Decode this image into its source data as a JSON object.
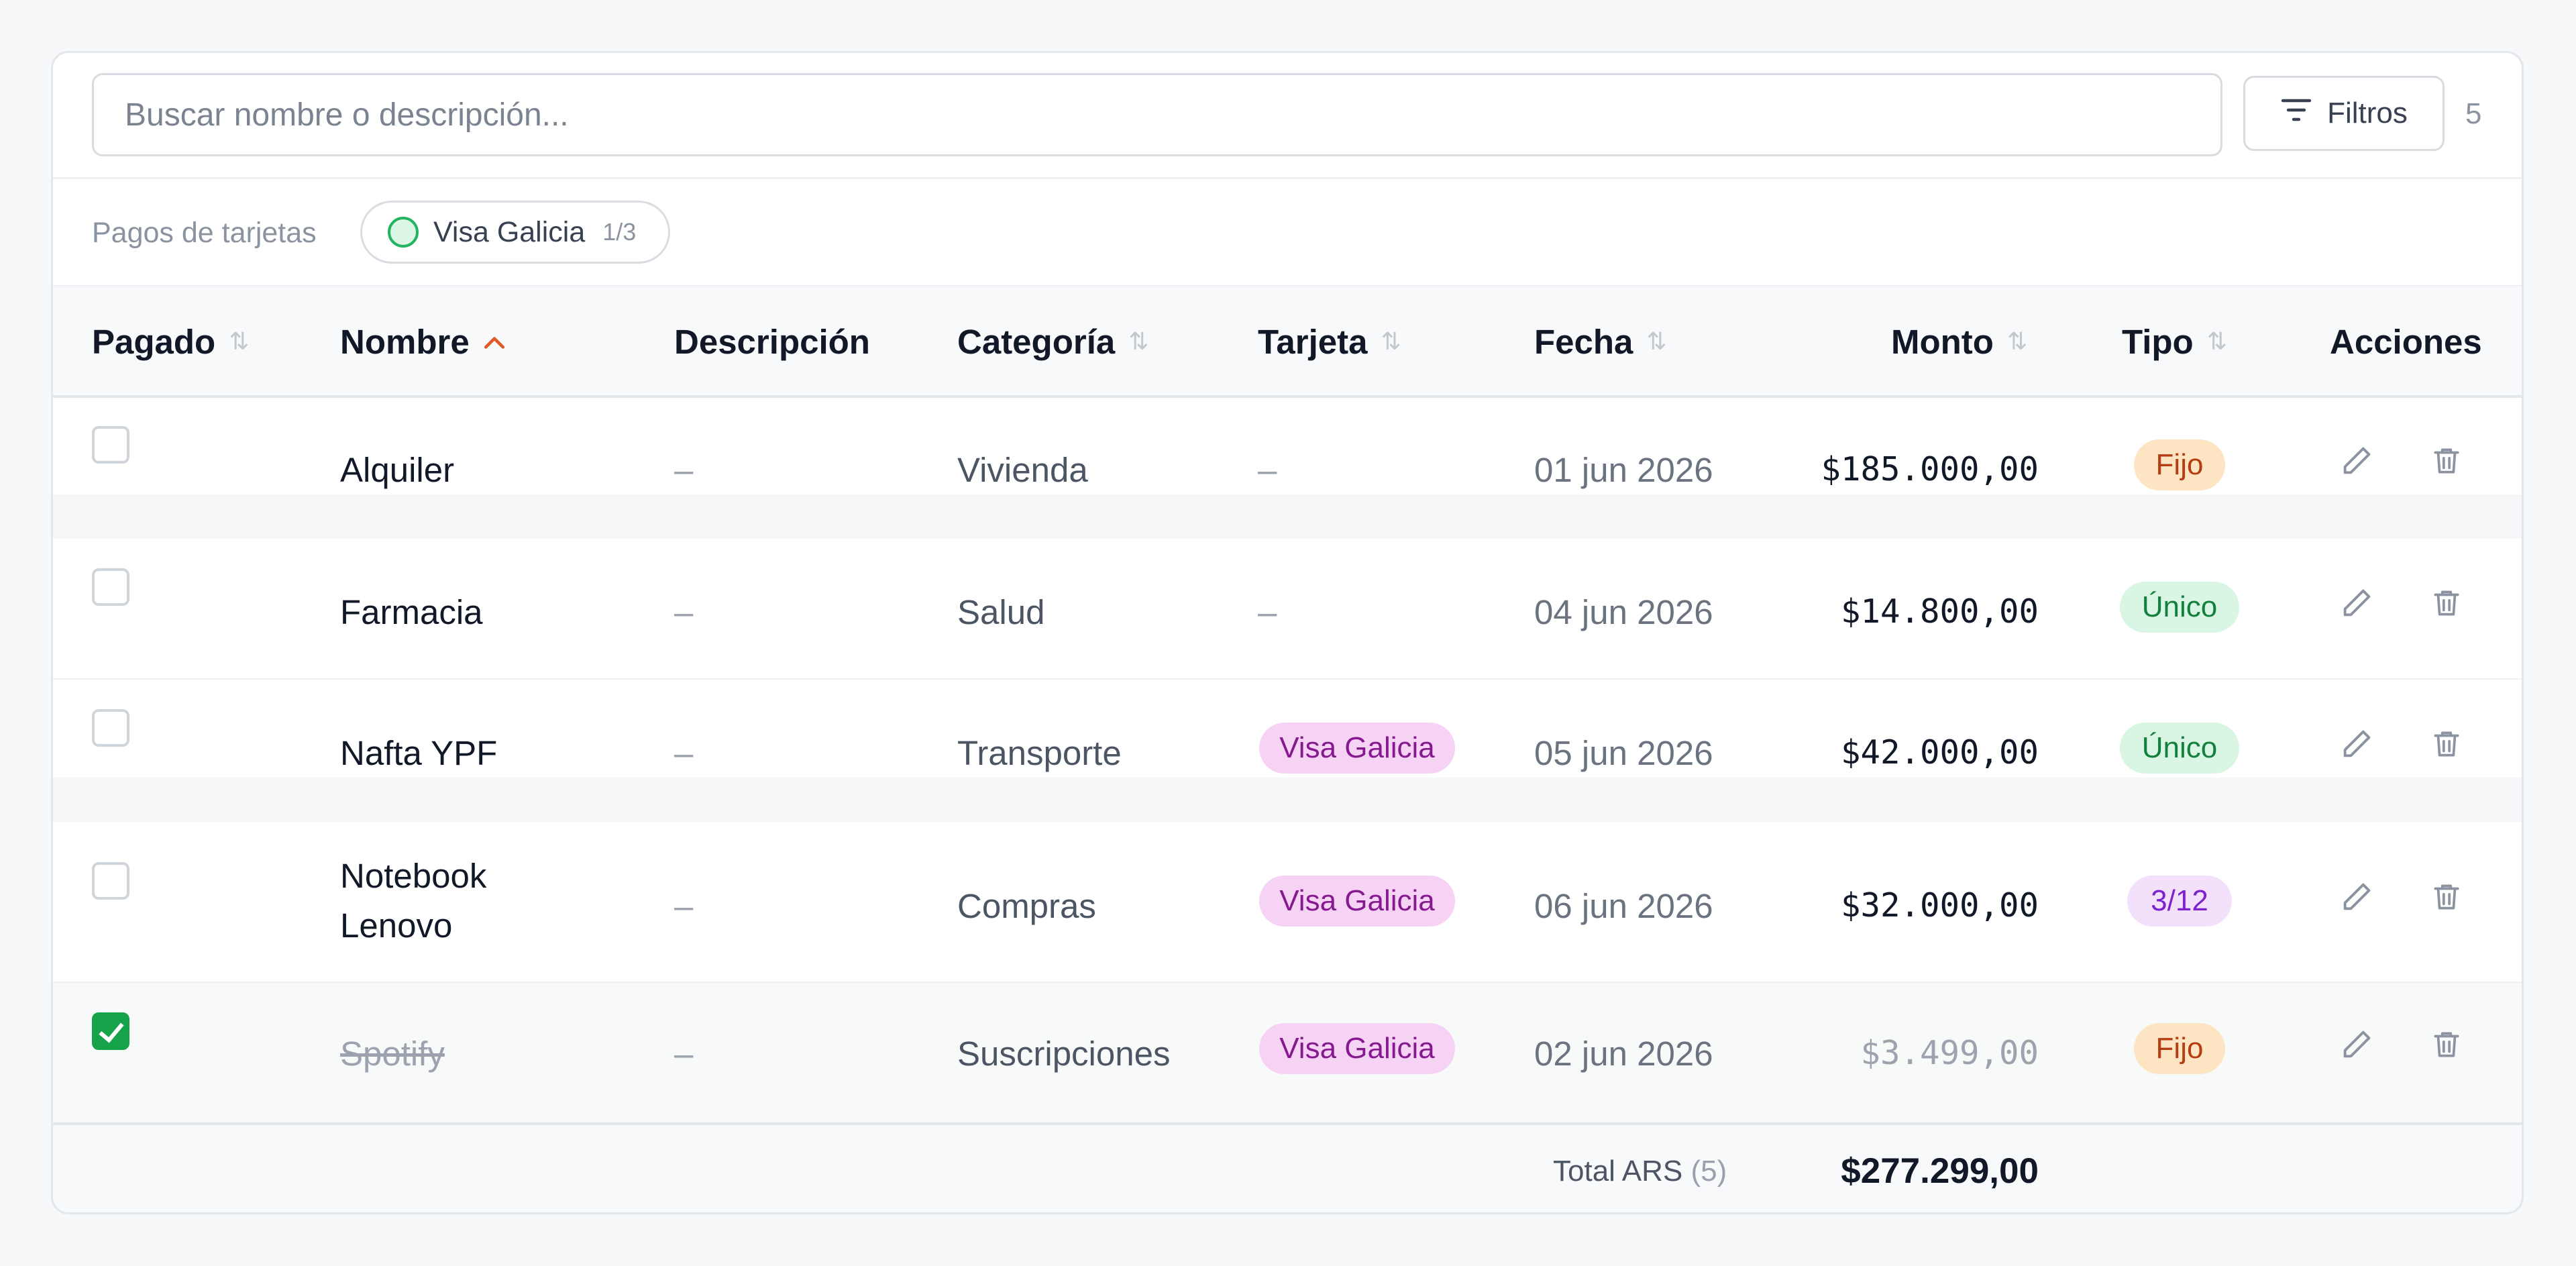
{
  "toolbar": {
    "search_placeholder": "Buscar nombre o descripción...",
    "filters_label": "Filtros",
    "result_count": "5"
  },
  "card_filter": {
    "label": "Pagos de tarjetas",
    "chip_label": "Visa Galicia",
    "chip_count": "1/3"
  },
  "columns": {
    "paid": "Pagado",
    "name": "Nombre",
    "description": "Descripción",
    "category": "Categoría",
    "card": "Tarjeta",
    "date": "Fecha",
    "amount": "Monto",
    "type": "Tipo",
    "actions": "Acciones"
  },
  "rows": [
    {
      "paid": false,
      "name": "Alquiler",
      "description": "–",
      "category": "Vivienda",
      "card": "–",
      "date": "01 jun 2026",
      "amount": "$185.000,00",
      "type": "Fijo"
    },
    {
      "paid": false,
      "name": "Farmacia",
      "description": "–",
      "category": "Salud",
      "card": "–",
      "date": "04 jun 2026",
      "amount": "$14.800,00",
      "type": "Único"
    },
    {
      "paid": false,
      "name": "Nafta YPF",
      "description": "–",
      "category": "Transporte",
      "card": "Visa Galicia",
      "date": "05 jun 2026",
      "amount": "$42.000,00",
      "type": "Único"
    },
    {
      "paid": false,
      "name": "Notebook Lenovo",
      "description": "–",
      "category": "Compras",
      "card": "Visa Galicia",
      "date": "06 jun 2026",
      "amount": "$32.000,00",
      "type": "3/12"
    },
    {
      "paid": true,
      "name": "Spotify",
      "description": "–",
      "category": "Suscripciones",
      "card": "Visa Galicia",
      "date": "02 jun 2026",
      "amount": "$3.499,00",
      "type": "Fijo"
    }
  ],
  "footer": {
    "total_label": "Total ARS",
    "total_count": "(5)",
    "total_amount": "$277.299,00"
  },
  "colors": {
    "accent_sort": "#e05a2b",
    "paid_green": "#16a34a",
    "card_pill": "#f6d2f5"
  },
  "icons": [
    "filter-icon",
    "sort-icon",
    "sort-asc-icon",
    "edit-icon",
    "delete-icon",
    "check-icon"
  ]
}
